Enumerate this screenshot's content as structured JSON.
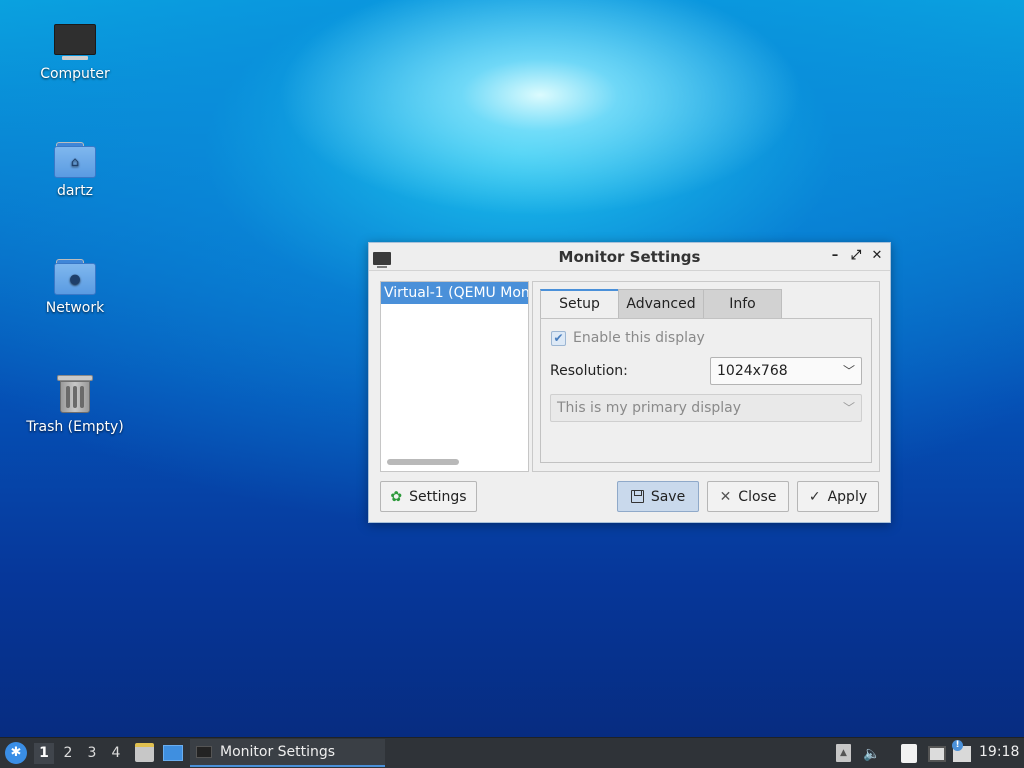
{
  "desktop": {
    "icons": [
      {
        "label": "Computer",
        "icon": "computer-icon"
      },
      {
        "label": "dartz",
        "icon": "home-folder-icon"
      },
      {
        "label": "Network",
        "icon": "network-folder-icon"
      },
      {
        "label": "Trash (Empty)",
        "icon": "trash-icon"
      }
    ]
  },
  "window": {
    "title": "Monitor Settings",
    "controls": {
      "minimize": "–",
      "maximize": "⤢",
      "close": "✕"
    },
    "display_list": [
      "Virtual-1 (QEMU Mon"
    ],
    "tabs": [
      {
        "label": "Setup",
        "active": true
      },
      {
        "label": "Advanced",
        "active": false
      },
      {
        "label": "Info",
        "active": false
      }
    ],
    "setup": {
      "enable_label": "Enable this display",
      "enable_checked": true,
      "resolution_label": "Resolution:",
      "resolution_value": "1024x768",
      "primary_value": "This is my primary display"
    },
    "buttons": {
      "settings": "Settings",
      "save": "Save",
      "close": "Close",
      "apply": "Apply"
    }
  },
  "taskbar": {
    "workspaces": [
      "1",
      "2",
      "3",
      "4"
    ],
    "active_workspace": "1",
    "task_label": "Monitor Settings",
    "clock": "19:18"
  },
  "colors": {
    "accent": "#4a90d9",
    "taskbar_bg": "#2f3338",
    "window_bg": "#efefef"
  }
}
